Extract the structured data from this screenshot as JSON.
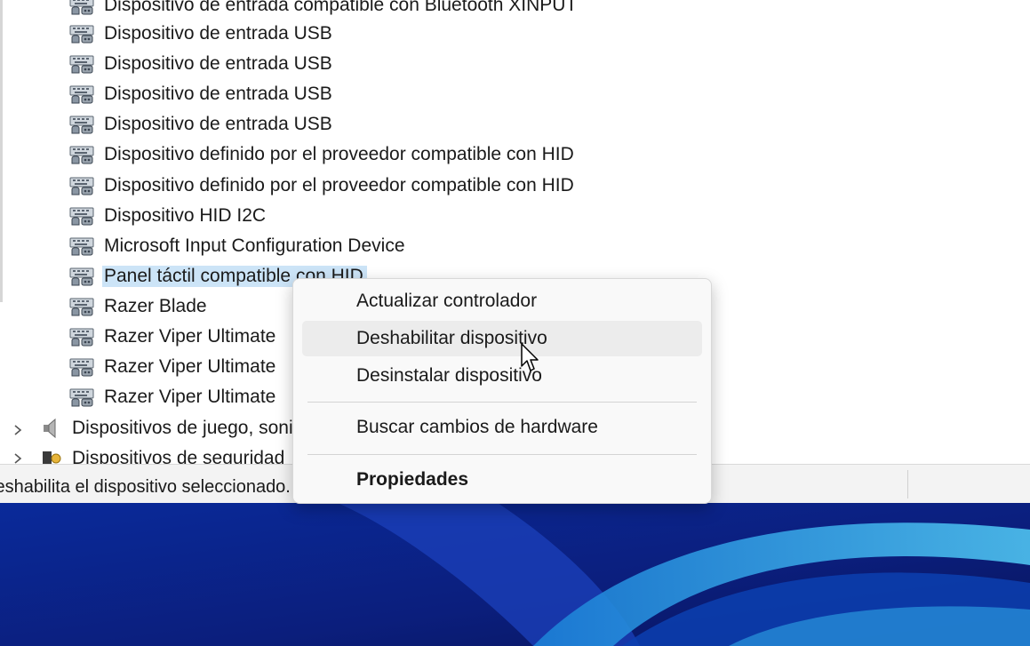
{
  "tree": {
    "items": [
      {
        "label": "Dispositivo de entrada compatible con Bluetooth XINPUT",
        "icon": "hid-device-icon"
      },
      {
        "label": "Dispositivo de entrada USB",
        "icon": "hid-device-icon"
      },
      {
        "label": "Dispositivo de entrada USB",
        "icon": "hid-device-icon"
      },
      {
        "label": "Dispositivo de entrada USB",
        "icon": "hid-device-icon"
      },
      {
        "label": "Dispositivo de entrada USB",
        "icon": "hid-device-icon"
      },
      {
        "label": "Dispositivo definido por el proveedor compatible con HID",
        "icon": "hid-device-icon"
      },
      {
        "label": "Dispositivo definido por el proveedor compatible con HID",
        "icon": "hid-device-icon"
      },
      {
        "label": "Dispositivo HID I2C",
        "icon": "hid-device-icon"
      },
      {
        "label": "Microsoft Input Configuration Device",
        "icon": "hid-device-icon"
      },
      {
        "label": "Panel táctil compatible con HID",
        "icon": "hid-device-icon",
        "selected": true
      },
      {
        "label": "Razer Blade",
        "icon": "hid-device-icon"
      },
      {
        "label": "Razer Viper Ultimate",
        "icon": "hid-device-icon"
      },
      {
        "label": "Razer Viper Ultimate",
        "icon": "hid-device-icon"
      },
      {
        "label": "Razer Viper Ultimate",
        "icon": "hid-device-icon"
      }
    ],
    "categories": [
      {
        "label": "Dispositivos de juego, sonido y vídeo",
        "icon": "speaker-icon"
      },
      {
        "label": "Dispositivos de seguridad",
        "icon": "security-device-icon"
      }
    ]
  },
  "statusbar": {
    "text": "Deshabilita el dispositivo seleccionado."
  },
  "context_menu": {
    "items": [
      {
        "label": "Actualizar controlador"
      },
      {
        "label": "Deshabilitar dispositivo",
        "hover": true
      },
      {
        "label": "Desinstalar dispositivo"
      },
      {
        "label": "Buscar cambios de hardware"
      },
      {
        "label": "Propiedades",
        "bold": true
      }
    ]
  },
  "colors": {
    "selection": "#cce4f7",
    "menu_bg": "#f9f9f9",
    "desktop_bg": "#0d2a8c"
  }
}
